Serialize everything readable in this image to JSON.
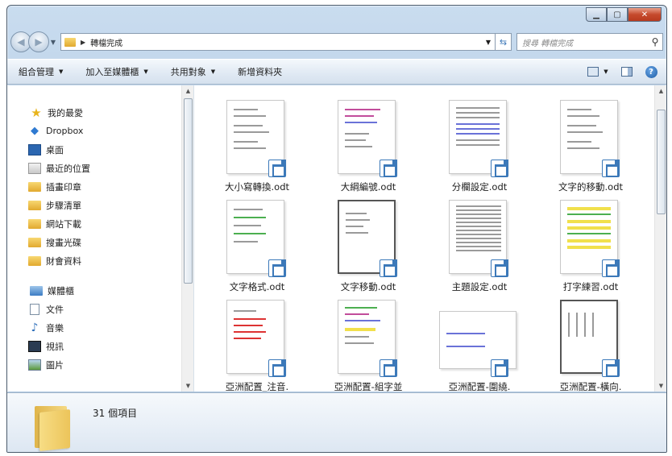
{
  "window": {
    "caption_buttons": [
      "min",
      "max",
      "close"
    ]
  },
  "address_bar": {
    "path": "轉檔完成",
    "search_placeholder": "搜尋 轉檔完成"
  },
  "toolbar": {
    "organize": "組合管理",
    "include_library": "加入至媒體櫃",
    "share": "共用對象",
    "new_folder": "新增資料夾"
  },
  "nav": {
    "favorites": "我的最愛",
    "dropbox": "Dropbox",
    "desktop": "桌面",
    "recent": "最近的位置",
    "folders": [
      "插畫印章",
      "步驟清單",
      "網站下載",
      "搜畫光碟",
      "財會資料"
    ],
    "libraries": "媒體櫃",
    "documents": "文件",
    "music": "音樂",
    "videos": "視訊",
    "pictures": "圖片"
  },
  "files": [
    {
      "name": "大小寫轉換.odt",
      "style": "plain"
    },
    {
      "name": "大綱編號.odt",
      "style": "pink"
    },
    {
      "name": "分欄設定.odt",
      "style": "blue"
    },
    {
      "name": "文字的移動.odt",
      "style": "plain"
    },
    {
      "name": "文字格式.odt",
      "style": "green"
    },
    {
      "name": "文字移動.odt",
      "style": "framed"
    },
    {
      "name": "主題設定.odt",
      "style": "dense"
    },
    {
      "name": "打字練習.odt",
      "style": "yellow"
    },
    {
      "name": "亞洲配置_注音.",
      "style": "red"
    },
    {
      "name": "亞洲配置-組字並",
      "style": "mixed"
    },
    {
      "name": "亞洲配置-圍繞.",
      "style": "landscape"
    },
    {
      "name": "亞洲配置-橫向.",
      "style": "vertical"
    }
  ],
  "details": {
    "count": "31 個項目"
  }
}
